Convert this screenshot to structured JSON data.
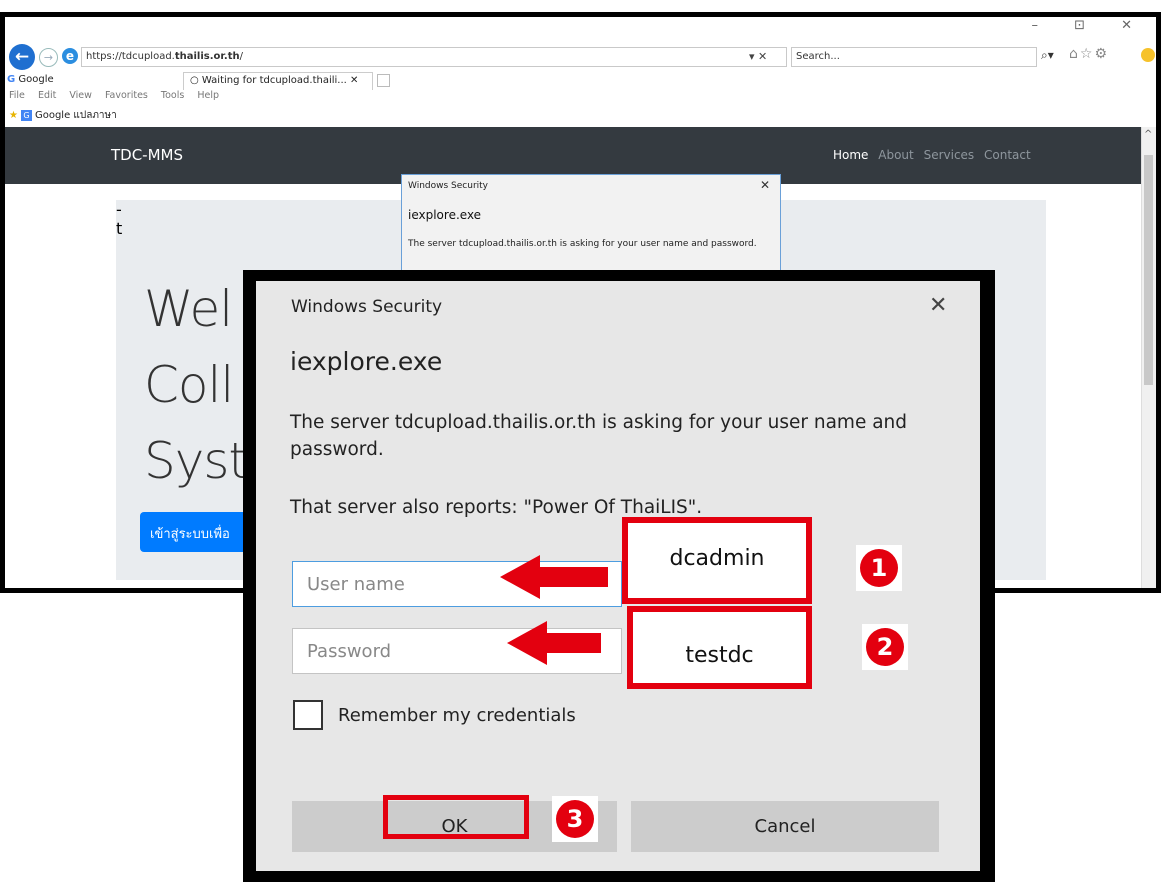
{
  "browser": {
    "address": "https://tdcupload.",
    "address_host": "thailis.or.th",
    "address_tail": "/",
    "address_controls": "▾ ✕",
    "search_placeholder": "Search...",
    "tab_google": "Google",
    "tab_google_letter": "G",
    "tab_active": "Waiting for tdcupload.thaili...",
    "tab_close": "✕",
    "menu": [
      "File",
      "Edit",
      "View",
      "Favorites",
      "Tools",
      "Help"
    ],
    "favorite": "Google แปลภาษา",
    "window_controls": "– ⊡ ✕"
  },
  "site": {
    "brand": "TDC-MMS",
    "nav": [
      "Home",
      "About",
      "Services",
      "Contact"
    ],
    "hero_lines": [
      "Wel",
      "Coll",
      "Syst"
    ],
    "hero_right": [
      "-",
      "t"
    ],
    "login_button": "เข้าสู่ระบบเพื่อ"
  },
  "small_dialog": {
    "title": "Windows Security",
    "close": "✕",
    "app": "iexplore.exe",
    "message": "The server tdcupload.thailis.or.th is asking for your user name and password."
  },
  "dialog": {
    "title": "Windows Security",
    "close": "✕",
    "app": "iexplore.exe",
    "message": "The server tdcupload.thailis.or.th is asking for your user name and password.",
    "realm": "That server also reports: \"Power Of ThaiLIS\".",
    "username_placeholder": "User name",
    "password_placeholder": "Password",
    "remember_label": "Remember my credentials",
    "ok": "OK",
    "cancel": "Cancel"
  },
  "annotations": {
    "username_value": "dcadmin",
    "password_value": "testdc",
    "step_1": "1",
    "step_2": "2",
    "step_3": "3",
    "accent_color": "#e3000f"
  }
}
